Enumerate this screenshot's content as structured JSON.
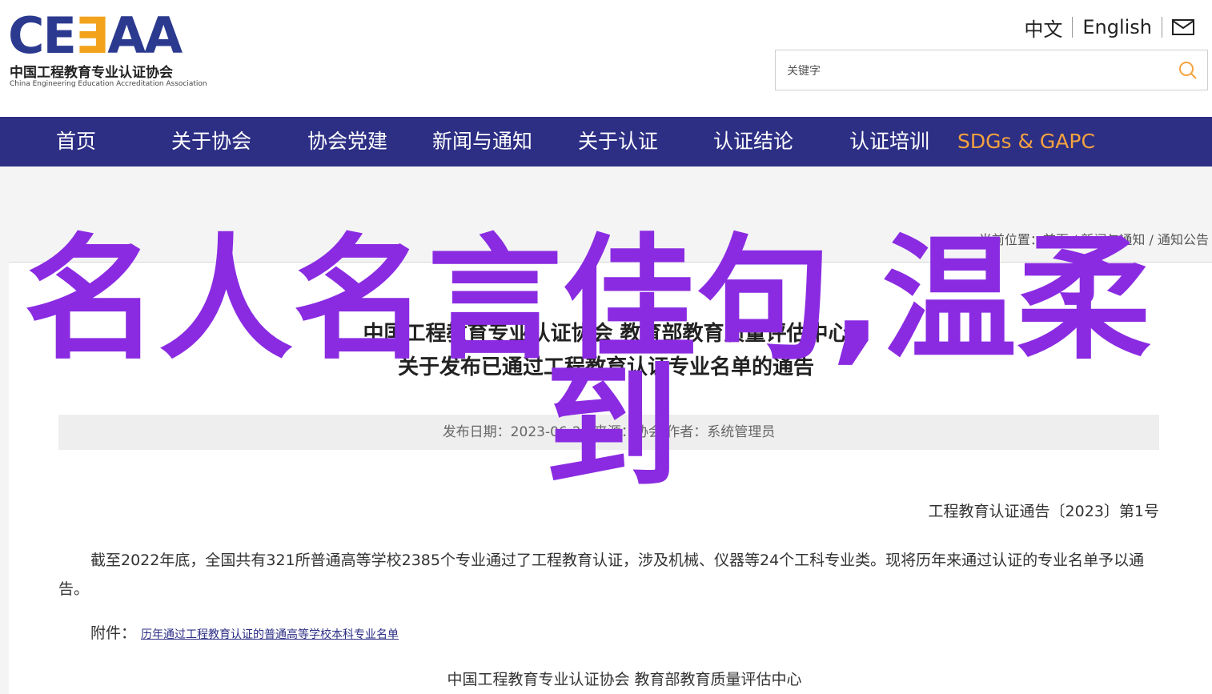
{
  "header": {
    "logo_mark_c": "CE",
    "logo_mark_e": "∃",
    "logo_mark_aa": "AA",
    "logo_cn": "中国工程教育专业认证协会",
    "logo_en": "China Engineering Education Accreditation Association",
    "lang_cn": "中文",
    "lang_en": "English",
    "search_placeholder": "关键字"
  },
  "nav": {
    "items": [
      "首页",
      "关于协会",
      "协会党建",
      "新闻与通知",
      "关于认证",
      "认证结论",
      "认证培训",
      "SDGs & GAPC"
    ]
  },
  "breadcrumb": "当前位置：首页 / 新闻与通知 / 通知公告",
  "article": {
    "title_line1": "中国工程教育专业认证协会 教育部教育质量评估中心",
    "title_line2": "关于发布已通过工程教育认证专业名单的通告",
    "meta": "发布日期：2023-06-28  来源：协会    作者：系统管理员",
    "notice_no": "工程教育认证通告〔2023〕第1号",
    "paragraph": "截至2022年底，全国共有321所普通高等学校2385个专业通过了工程教育认证，涉及机械、仪器等24个工科专业类。现将历年来通过认证的专业名单予以通告。",
    "attachment_label": "附件：",
    "attachment_link": "历年通过工程教育认证的普通高等学校本科专业名单",
    "signature": "中国工程教育专业认证协会     教育部教育质量评估中心"
  },
  "overlay": {
    "line1": "名人名言佳句,温柔",
    "line2": "到",
    "color": "#8a2be2"
  },
  "colors": {
    "nav_bg": "#2d2f85",
    "nav_accent": "#f5a23e",
    "logo_blue": "#2b3a8f",
    "logo_orange": "#f2a31b"
  }
}
